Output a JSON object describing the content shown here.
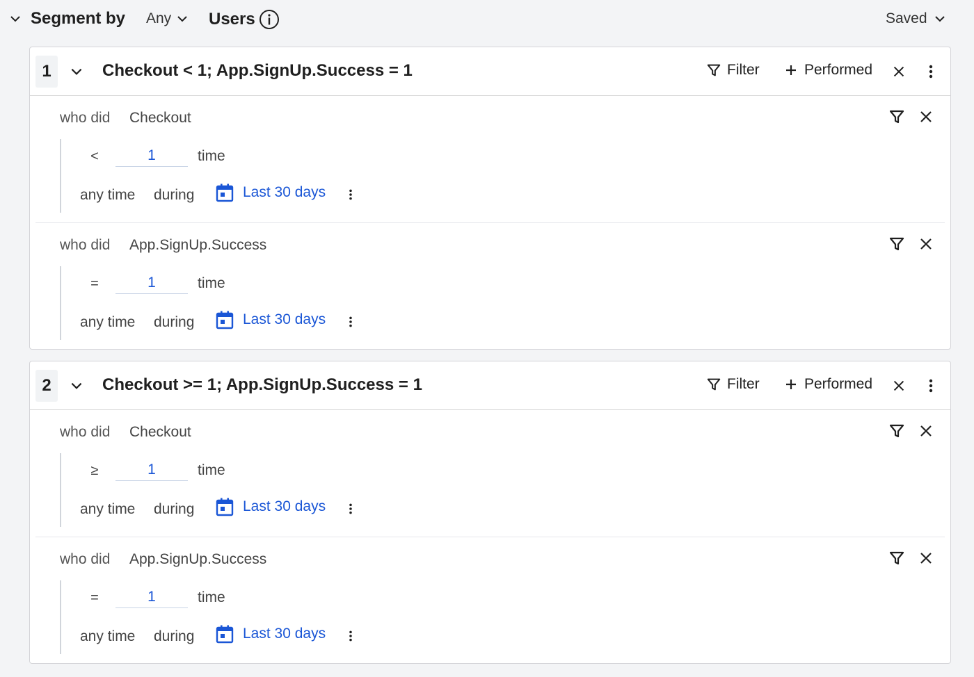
{
  "segment_header": {
    "title": "Segment by",
    "any_selector": "Any",
    "users_label": "Users",
    "saved_selector": "Saved"
  },
  "colors": {
    "accent": "#1a56d6",
    "background": "#f3f4f6",
    "card": "#ffffff"
  },
  "segments": [
    {
      "index": "1",
      "name": "Checkout < 1; App.SignUp.Success = 1",
      "filter_label": "Filter",
      "performed_label": "Performed",
      "conditions": [
        {
          "who_did": "who did",
          "event": "Checkout",
          "operator": "<",
          "count": "1",
          "unit": "time",
          "when": "any time",
          "during": "during",
          "date_range": "Last 30 days"
        },
        {
          "who_did": "who did",
          "event": "App.SignUp.Success",
          "operator": "=",
          "count": "1",
          "unit": "time",
          "when": "any time",
          "during": "during",
          "date_range": "Last 30 days"
        }
      ]
    },
    {
      "index": "2",
      "name": "Checkout >= 1; App.SignUp.Success = 1",
      "filter_label": "Filter",
      "performed_label": "Performed",
      "conditions": [
        {
          "who_did": "who did",
          "event": "Checkout",
          "operator": "≥",
          "count": "1",
          "unit": "time",
          "when": "any time",
          "during": "during",
          "date_range": "Last 30 days"
        },
        {
          "who_did": "who did",
          "event": "App.SignUp.Success",
          "operator": "=",
          "count": "1",
          "unit": "time",
          "when": "any time",
          "during": "during",
          "date_range": "Last 30 days"
        }
      ]
    }
  ]
}
